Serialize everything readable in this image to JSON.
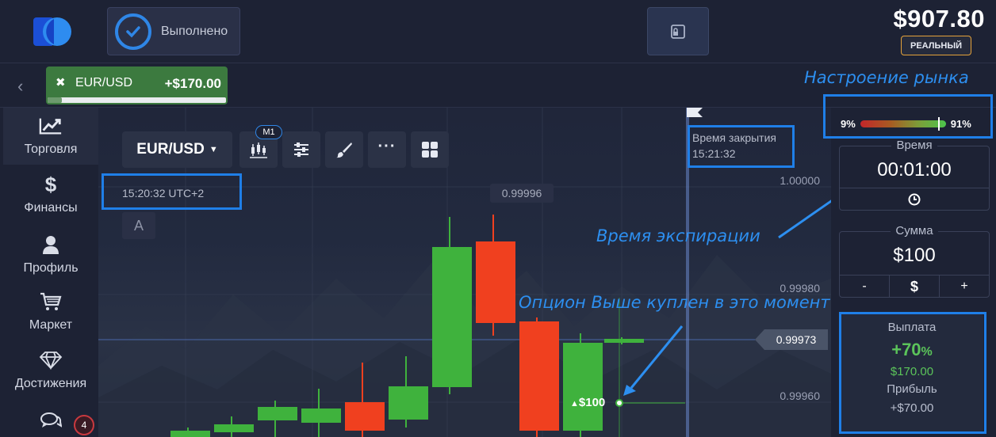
{
  "header": {
    "done_label": "Выполнено",
    "balance": "$907.80",
    "account_type": "РЕАЛЬНЫЙ"
  },
  "tab": {
    "pair": "EUR/USD",
    "profit": "+$170.00",
    "progress": 0.08
  },
  "sidebar": {
    "items": [
      {
        "label": "Торговля",
        "icon": "trend-chart-icon"
      },
      {
        "label": "Финансы",
        "icon": "dollar-icon"
      },
      {
        "label": "Профиль",
        "icon": "user-icon"
      },
      {
        "label": "Маркет",
        "icon": "cart-icon"
      },
      {
        "label": "Достижения",
        "icon": "diamond-icon"
      }
    ],
    "chat_count": "4"
  },
  "chart": {
    "pair_select": "EUR/USD",
    "timeframe": "M1",
    "clock": "15:20:32 UTC+2",
    "font_toggle": "A",
    "close_label": "Время закрытия",
    "close_time": "15:21:32",
    "top_price": "0.99996",
    "current_price": "0.99973",
    "trade_marker": "$100",
    "price_labels": [
      "1.00000",
      "0.99980",
      "0.99960"
    ]
  },
  "chart_data": {
    "type": "candlestick",
    "timeframe": "M1",
    "y_labels": [
      "1.00000",
      "0.99980",
      "0.99960"
    ],
    "current_price": 0.99973
  },
  "annotations": {
    "sentiment": "Настроение рынка",
    "expiry": "Время экспирации",
    "option": "Опцион Выше куплен в это момент"
  },
  "panel": {
    "sentiment_low": "9%",
    "sentiment_high": "91%",
    "sentiment_value": 0.91,
    "time_label": "Время",
    "time_value": "00:01:00",
    "amount_label": "Сумма",
    "amount_value": "$100",
    "minus": "-",
    "currency": "$",
    "plus": "+",
    "payout_label": "Выплата",
    "payout_pct": "+70",
    "payout_pct_sign": "%",
    "payout_amount": "$170.00",
    "profit_label": "Прибыль",
    "profit_value": "+$70.00"
  },
  "colors": {
    "up": "#3fb23d",
    "down": "#f0401f",
    "accent": "#2f86e6",
    "annotation": "#2d8ff0"
  }
}
